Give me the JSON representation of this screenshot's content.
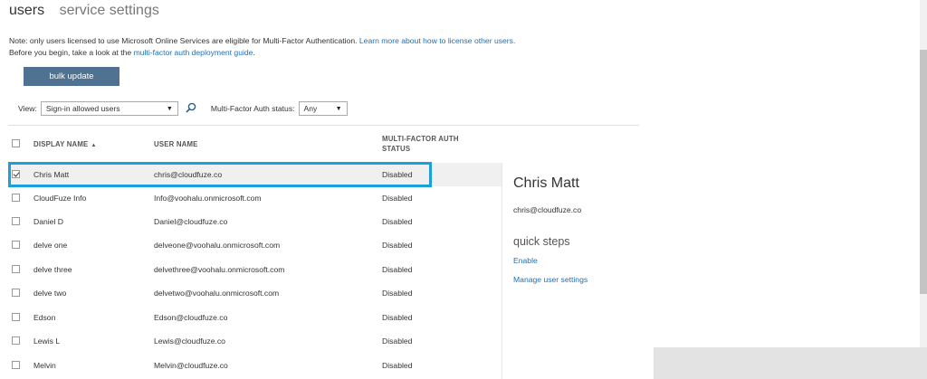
{
  "tabs": [
    {
      "label": "users",
      "active": true
    },
    {
      "label": "service settings",
      "active": false
    }
  ],
  "note": {
    "line1_text": "Note: only users licensed to use Microsoft Online Services are eligible for Multi-Factor Authentication.",
    "line1_link": "Learn more about how to license other users.",
    "line2_text": "Before you begin, take a look at the",
    "line2_link": "multi-factor auth deployment guide",
    "line2_end": "."
  },
  "bulk_update_label": "bulk update",
  "filters": {
    "view_label": "View:",
    "view_value": "Sign-in allowed users",
    "status_label": "Multi-Factor Auth status:",
    "status_value": "Any",
    "search_icon": "search-icon"
  },
  "columns": {
    "display_name": "DISPLAY NAME",
    "user_name": "USER NAME",
    "mfa_line1": "MULTI-FACTOR AUTH",
    "mfa_line2": "STATUS"
  },
  "rows": [
    {
      "display_name": "Chris Matt",
      "user_name": "chris@cloudfuze.co",
      "status": "Disabled",
      "checked": true
    },
    {
      "display_name": "CloudFuze Info",
      "user_name": "Info@voohalu.onmicrosoft.com",
      "status": "Disabled",
      "checked": false
    },
    {
      "display_name": "Daniel D",
      "user_name": "Daniel@cloudfuze.co",
      "status": "Disabled",
      "checked": false
    },
    {
      "display_name": "delve one",
      "user_name": "delveone@voohalu.onmicrosoft.com",
      "status": "Disabled",
      "checked": false
    },
    {
      "display_name": "delve three",
      "user_name": "delvethree@voohalu.onmicrosoft.com",
      "status": "Disabled",
      "checked": false
    },
    {
      "display_name": "delve two",
      "user_name": "delvetwo@voohalu.onmicrosoft.com",
      "status": "Disabled",
      "checked": false
    },
    {
      "display_name": "Edson",
      "user_name": "Edson@cloudfuze.co",
      "status": "Disabled",
      "checked": false
    },
    {
      "display_name": "Lewis L",
      "user_name": "Lewis@cloudfuze.co",
      "status": "Disabled",
      "checked": false
    },
    {
      "display_name": "Melvin",
      "user_name": "Melvin@cloudfuze.co",
      "status": "Disabled",
      "checked": false
    }
  ],
  "detail": {
    "name": "Chris Matt",
    "email": "chris@cloudfuze.co",
    "quick_steps_title": "quick steps",
    "enable_link": "Enable",
    "manage_link": "Manage user settings"
  },
  "colors": {
    "highlight": "#1aa1dc",
    "button": "#4f7292",
    "link": "#1e6fb3"
  }
}
